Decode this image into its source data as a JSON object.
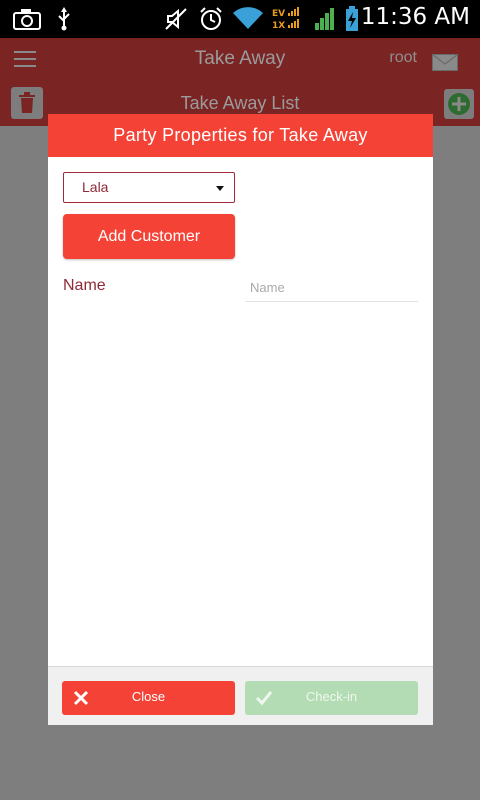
{
  "status_bar": {
    "time": "11:36 AM",
    "icons": [
      "camera-icon",
      "usb-icon",
      "mute-icon",
      "alarm-icon",
      "wifi-icon",
      "evdo-signal-icon",
      "signal-icon",
      "battery-charging-icon"
    ],
    "network_label_top": "EV",
    "network_label_bottom": "1X"
  },
  "app_bar": {
    "title": "Take Away",
    "user": "root",
    "icons": [
      "menu-icon",
      "mail-icon"
    ]
  },
  "sub_bar": {
    "title": "Take Away List",
    "icons": [
      "trash-icon",
      "add-circle-icon"
    ]
  },
  "dialog": {
    "title": "Party Properties for Take Away",
    "customer_select": {
      "selected": "Lala"
    },
    "add_customer_label": "Add Customer",
    "name_label": "Name",
    "name_input": {
      "value": "",
      "placeholder": "Name"
    },
    "footer": {
      "close_label": "Close",
      "checkin_label": "Check-in"
    }
  },
  "colors": {
    "accent": "#f44336",
    "app_bar_dimmed": "#7b2424",
    "overlay": "#7e7e7e",
    "checkin_disabled": "#b3dcb4",
    "label_text": "#8f2a36"
  }
}
